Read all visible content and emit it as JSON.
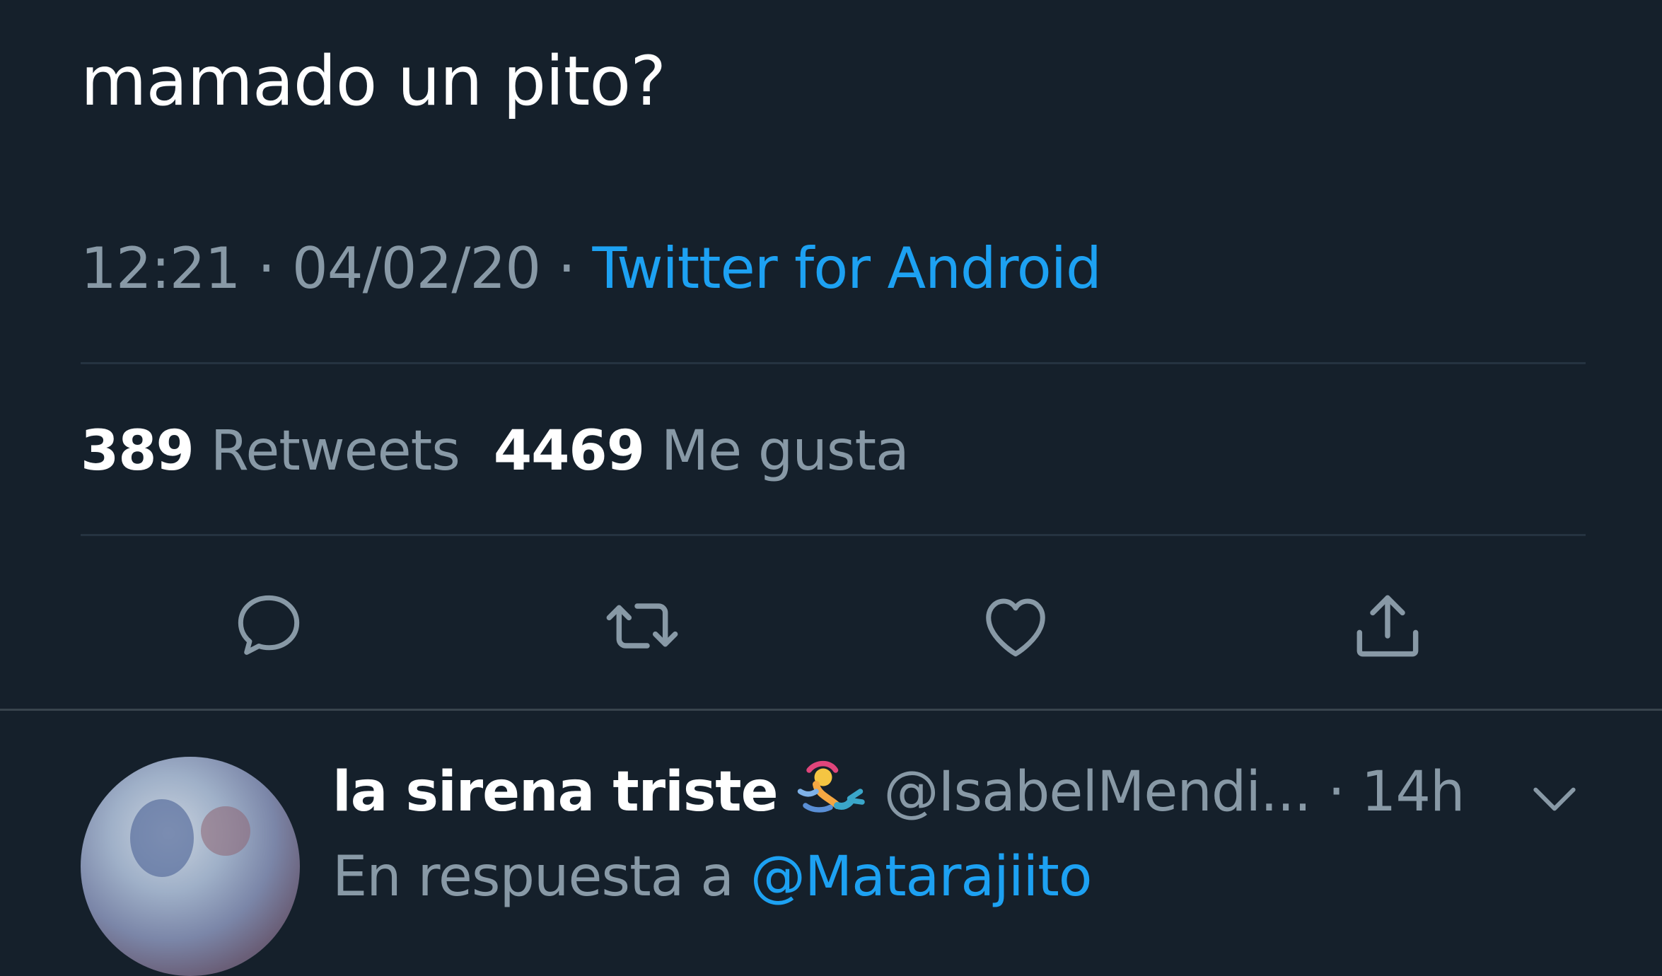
{
  "tweet": {
    "text": "mamado un pito?",
    "time": "12:21",
    "date": "04/02/20",
    "separator": "·",
    "source": "Twitter for Android"
  },
  "stats": {
    "retweets_count": "389",
    "retweets_label": "Retweets",
    "likes_count": "4469",
    "likes_label": "Me gusta"
  },
  "actions": [
    {
      "icon": "reply-icon"
    },
    {
      "icon": "retweet-icon"
    },
    {
      "icon": "like-icon"
    },
    {
      "icon": "share-icon"
    }
  ],
  "reply": {
    "name": "la sirena triste",
    "name_emoji": "mermaid-emoji",
    "handle": "@IsabelMendi...",
    "time": "· 14h",
    "reply_to_prefix": "En respuesta a",
    "reply_to_mention": "@Matarajiito"
  },
  "colors": {
    "background": "#15202b",
    "text_primary": "#ffffff",
    "text_secondary": "#8899a6",
    "accent": "#1da1f2",
    "divider": "#253341"
  }
}
